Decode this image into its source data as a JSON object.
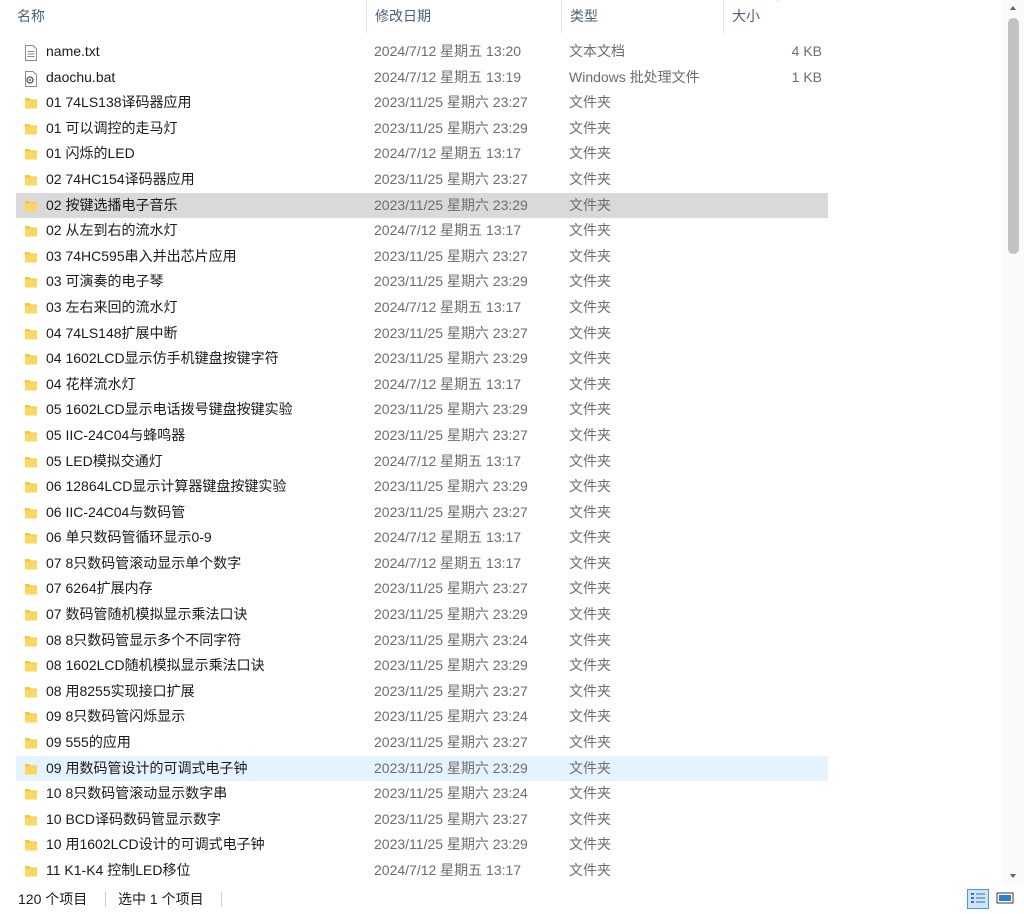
{
  "columns": {
    "name": "名称",
    "date": "修改日期",
    "type": "类型",
    "size": "大小"
  },
  "sort_indicator": "chevron-down-icon",
  "colors": {
    "folder": "#f4c542",
    "selected_row": "#d9d9d9",
    "hover_row": "#e5f3ff",
    "header_text": "#4c607a",
    "view_active": "#cce4f7"
  },
  "files": [
    {
      "name": "name.txt",
      "date": "2024/7/12 星期五 13:20",
      "type": "文本文档",
      "size": "4 KB",
      "icon": "text-file-icon"
    },
    {
      "name": "daochu.bat",
      "date": "2024/7/12 星期五 13:19",
      "type": "Windows 批处理文件",
      "size": "1 KB",
      "icon": "batch-file-icon"
    },
    {
      "name": "01 74LS138译码器应用",
      "date": "2023/11/25 星期六 23:27",
      "type": "文件夹",
      "size": "",
      "icon": "folder-icon"
    },
    {
      "name": "01 可以调控的走马灯",
      "date": "2023/11/25 星期六 23:29",
      "type": "文件夹",
      "size": "",
      "icon": "folder-icon"
    },
    {
      "name": "01 闪烁的LED",
      "date": "2024/7/12 星期五 13:17",
      "type": "文件夹",
      "size": "",
      "icon": "folder-icon"
    },
    {
      "name": "02 74HC154译码器应用",
      "date": "2023/11/25 星期六 23:27",
      "type": "文件夹",
      "size": "",
      "icon": "folder-icon"
    },
    {
      "name": "02 按键选播电子音乐",
      "date": "2023/11/25 星期六 23:29",
      "type": "文件夹",
      "size": "",
      "icon": "folder-icon",
      "state": "selected"
    },
    {
      "name": "02 从左到右的流水灯",
      "date": "2024/7/12 星期五 13:17",
      "type": "文件夹",
      "size": "",
      "icon": "folder-icon"
    },
    {
      "name": "03 74HC595串入并出芯片应用",
      "date": "2023/11/25 星期六 23:27",
      "type": "文件夹",
      "size": "",
      "icon": "folder-icon"
    },
    {
      "name": "03 可演奏的电子琴",
      "date": "2023/11/25 星期六 23:29",
      "type": "文件夹",
      "size": "",
      "icon": "folder-icon"
    },
    {
      "name": "03 左右来回的流水灯",
      "date": "2024/7/12 星期五 13:17",
      "type": "文件夹",
      "size": "",
      "icon": "folder-icon"
    },
    {
      "name": "04 74LS148扩展中断",
      "date": "2023/11/25 星期六 23:27",
      "type": "文件夹",
      "size": "",
      "icon": "folder-icon"
    },
    {
      "name": "04 1602LCD显示仿手机键盘按键字符",
      "date": "2023/11/25 星期六 23:29",
      "type": "文件夹",
      "size": "",
      "icon": "folder-icon"
    },
    {
      "name": "04 花样流水灯",
      "date": "2024/7/12 星期五 13:17",
      "type": "文件夹",
      "size": "",
      "icon": "folder-icon"
    },
    {
      "name": "05 1602LCD显示电话拨号键盘按键实验",
      "date": "2023/11/25 星期六 23:29",
      "type": "文件夹",
      "size": "",
      "icon": "folder-icon"
    },
    {
      "name": "05 IIC-24C04与蜂鸣器",
      "date": "2023/11/25 星期六 23:27",
      "type": "文件夹",
      "size": "",
      "icon": "folder-icon"
    },
    {
      "name": "05 LED模拟交通灯",
      "date": "2024/7/12 星期五 13:17",
      "type": "文件夹",
      "size": "",
      "icon": "folder-icon"
    },
    {
      "name": "06 12864LCD显示计算器键盘按键实验",
      "date": "2023/11/25 星期六 23:29",
      "type": "文件夹",
      "size": "",
      "icon": "folder-icon"
    },
    {
      "name": "06 IIC-24C04与数码管",
      "date": "2023/11/25 星期六 23:27",
      "type": "文件夹",
      "size": "",
      "icon": "folder-icon"
    },
    {
      "name": "06 单只数码管循环显示0-9",
      "date": "2024/7/12 星期五 13:17",
      "type": "文件夹",
      "size": "",
      "icon": "folder-icon"
    },
    {
      "name": "07 8只数码管滚动显示单个数字",
      "date": "2024/7/12 星期五 13:17",
      "type": "文件夹",
      "size": "",
      "icon": "folder-icon"
    },
    {
      "name": "07 6264扩展内存",
      "date": "2023/11/25 星期六 23:27",
      "type": "文件夹",
      "size": "",
      "icon": "folder-icon"
    },
    {
      "name": "07 数码管随机模拟显示乘法口诀",
      "date": "2023/11/25 星期六 23:29",
      "type": "文件夹",
      "size": "",
      "icon": "folder-icon"
    },
    {
      "name": "08 8只数码管显示多个不同字符",
      "date": "2023/11/25 星期六 23:24",
      "type": "文件夹",
      "size": "",
      "icon": "folder-icon"
    },
    {
      "name": "08 1602LCD随机模拟显示乘法口诀",
      "date": "2023/11/25 星期六 23:29",
      "type": "文件夹",
      "size": "",
      "icon": "folder-icon"
    },
    {
      "name": "08 用8255实现接口扩展",
      "date": "2023/11/25 星期六 23:27",
      "type": "文件夹",
      "size": "",
      "icon": "folder-icon"
    },
    {
      "name": "09 8只数码管闪烁显示",
      "date": "2023/11/25 星期六 23:24",
      "type": "文件夹",
      "size": "",
      "icon": "folder-icon"
    },
    {
      "name": "09 555的应用",
      "date": "2023/11/25 星期六 23:27",
      "type": "文件夹",
      "size": "",
      "icon": "folder-icon"
    },
    {
      "name": "09 用数码管设计的可调式电子钟",
      "date": "2023/11/25 星期六 23:29",
      "type": "文件夹",
      "size": "",
      "icon": "folder-icon",
      "state": "hover"
    },
    {
      "name": "10 8只数码管滚动显示数字串",
      "date": "2023/11/25 星期六 23:24",
      "type": "文件夹",
      "size": "",
      "icon": "folder-icon"
    },
    {
      "name": "10 BCD译码数码管显示数字",
      "date": "2023/11/25 星期六 23:27",
      "type": "文件夹",
      "size": "",
      "icon": "folder-icon"
    },
    {
      "name": "10 用1602LCD设计的可调式电子钟",
      "date": "2023/11/25 星期六 23:29",
      "type": "文件夹",
      "size": "",
      "icon": "folder-icon"
    },
    {
      "name": "11 K1-K4 控制LED移位",
      "date": "2024/7/12 星期五 13:17",
      "type": "文件夹",
      "size": "",
      "icon": "folder-icon"
    }
  ],
  "status": {
    "item_count": "120 个项目",
    "selected": "选中 1 个项目"
  },
  "view_buttons": [
    {
      "name": "details-view-icon",
      "active": true
    },
    {
      "name": "large-icons-view-icon",
      "active": false
    }
  ]
}
